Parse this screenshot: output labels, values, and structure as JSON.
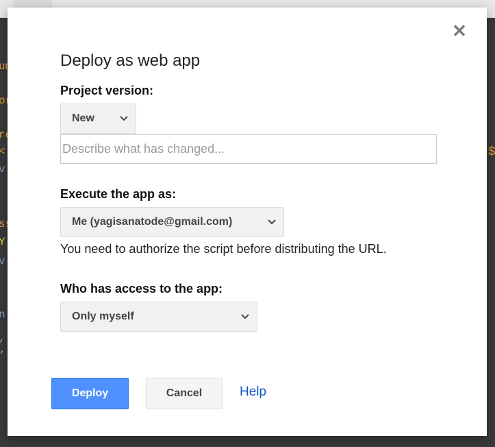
{
  "background": {
    "code_fragments": [
      "um",
      "or",
      "re",
      "<",
      "v",
      "ss",
      "Y",
      "v",
      "n",
      ",",
      "’"
    ],
    "right_glyph": "$"
  },
  "dialog": {
    "title": "Deploy as web app",
    "close_icon": "close-icon",
    "project_version": {
      "label": "Project version:",
      "selected": "New",
      "description_placeholder": "Describe what has changed...",
      "description_value": ""
    },
    "execute_as": {
      "label": "Execute the app as:",
      "selected": "Me (yagisanatode@gmail.com)",
      "note": "You need to authorize the script before distributing the URL."
    },
    "access": {
      "label": "Who has access to the app:",
      "selected": "Only myself"
    },
    "buttons": {
      "deploy": "Deploy",
      "cancel": "Cancel",
      "help": "Help"
    }
  },
  "colors": {
    "primary": "#4d90fe",
    "link": "#1155cc",
    "backdrop": "#3a3a3a"
  }
}
